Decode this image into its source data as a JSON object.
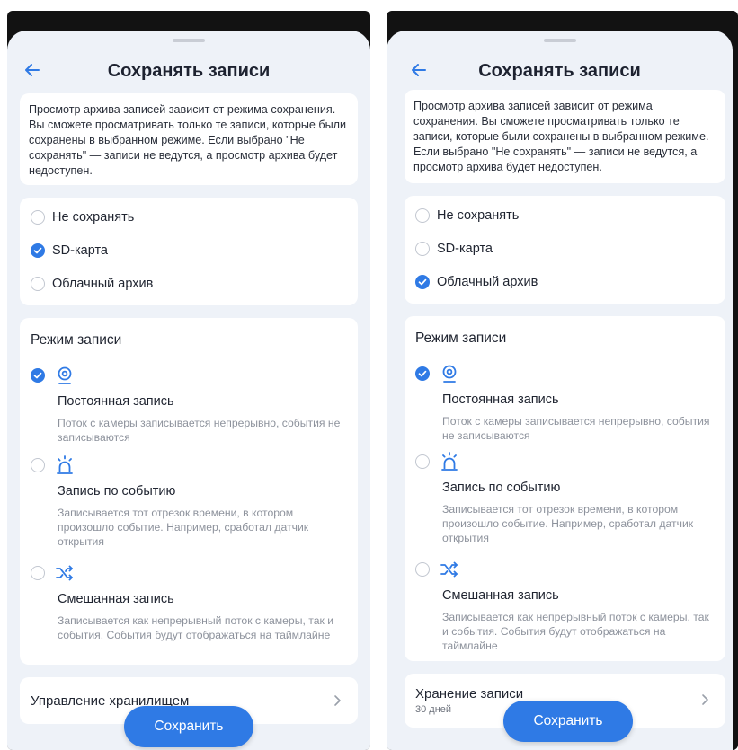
{
  "colors": {
    "accent": "#2f7ae5",
    "sheet_bg": "#eef2f8",
    "card_bg": "#ffffff",
    "muted_text": "#8d929c"
  },
  "screens": [
    {
      "title": "Сохранять записи",
      "info_text": "Просмотр архива записей зависит от режима сохранения. Вы сможете просматривать только те записи, которые были сохранены в выбранном режиме. Если выбрано \"Не сохранять\" — записи не ведутся, а просмотр архива будет недоступен.",
      "storage_options": [
        {
          "label": "Не сохранять",
          "selected": false
        },
        {
          "label": "SD-карта",
          "selected": true
        },
        {
          "label": "Облачный архив",
          "selected": false
        }
      ],
      "mode_section_title": "Режим записи",
      "modes": [
        {
          "icon": "camera-icon",
          "name": "Постоянная запись",
          "description": "Поток с камеры записывается непрерывно, события не записываются",
          "selected": true
        },
        {
          "icon": "alarm-siren-icon",
          "name": "Запись по событию",
          "description": "Записывается тот отрезок времени, в котором произошло событие. Например, сработал датчик открытия",
          "selected": false
        },
        {
          "icon": "shuffle-icon",
          "name": "Смешанная запись",
          "description": "Записывается как непрерывный поток с камеры, так и события. События будут отображаться на таймлайне",
          "selected": false
        }
      ],
      "storage_row": {
        "title": "Управление хранилищем",
        "subtitle": ""
      },
      "save_label": "Сохранить"
    },
    {
      "title": "Сохранять записи",
      "info_text": "Просмотр архива записей зависит от режима сохранения. Вы сможете просматривать только те записи, которые были сохранены в выбранном режиме. Если выбрано \"Не сохранять\" — записи не ведутся, а просмотр архива будет недоступен.",
      "storage_options": [
        {
          "label": "Не сохранять",
          "selected": false
        },
        {
          "label": "SD-карта",
          "selected": false
        },
        {
          "label": "Облачный архив",
          "selected": true
        }
      ],
      "mode_section_title": "Режим записи",
      "modes": [
        {
          "icon": "camera-icon",
          "name": "Постоянная запись",
          "description": "Поток с камеры записывается непрерывно, события не записываются",
          "selected": true
        },
        {
          "icon": "alarm-siren-icon",
          "name": "Запись по событию",
          "description": "Записывается тот отрезок времени, в котором произошло событие. Например, сработал датчик открытия",
          "selected": false
        },
        {
          "icon": "shuffle-icon",
          "name": "Смешанная запись",
          "description": "Записывается как непрерывный поток с камеры, так и события. События будут отображаться на таймлайне",
          "selected": false
        }
      ],
      "storage_row": {
        "title": "Хранение записи",
        "subtitle": "30 дней"
      },
      "save_label": "Сохранить"
    }
  ]
}
